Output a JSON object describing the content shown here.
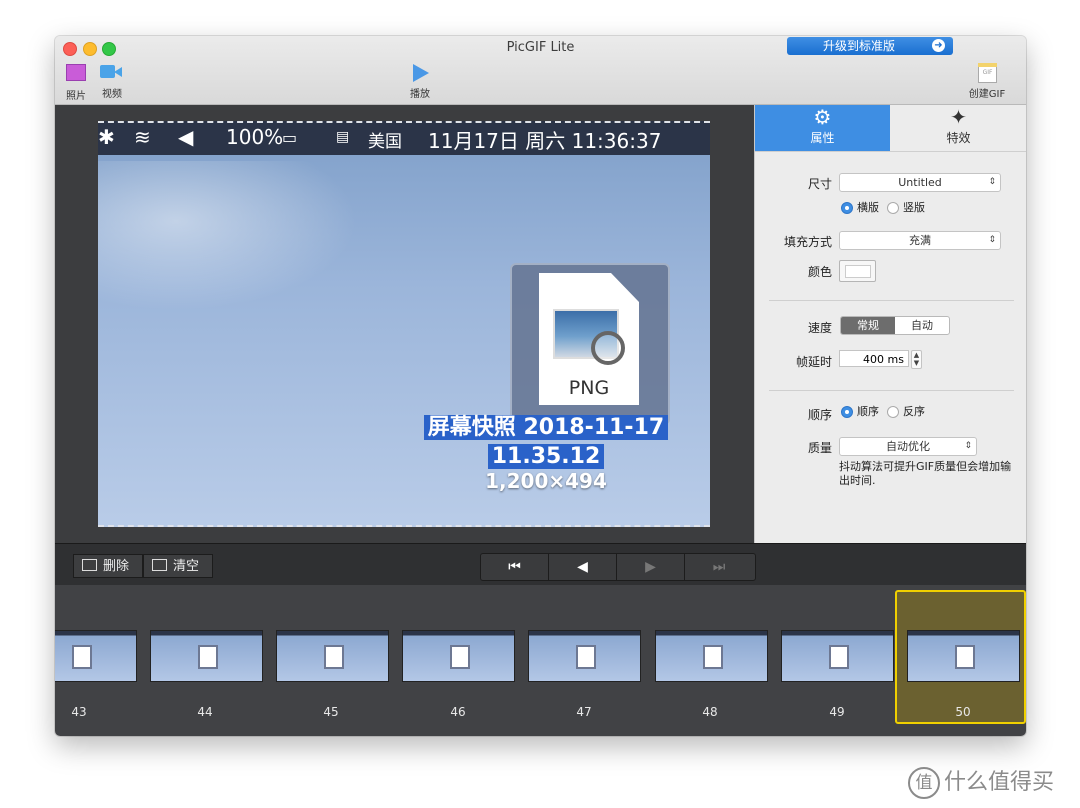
{
  "window": {
    "title": "PicGIF Lite",
    "upgrade_label": "升级到标准版"
  },
  "toolbar": {
    "photos": "照片",
    "video": "视频",
    "play": "播放",
    "create_gif": "创建GIF",
    "gif_icon_text": "GIF"
  },
  "preview": {
    "menubar": {
      "battery": "100%",
      "flag_lang": "美国",
      "datetime": "11月17日 周六  11:36:37"
    },
    "file_ext": "PNG",
    "filename_line1": "屏幕快照 2018-11-17",
    "filename_line2": "11.35.12",
    "dimensions": "1,200×494"
  },
  "sidebar": {
    "tabs": [
      {
        "label": "属性",
        "icon": "gear-icon"
      },
      {
        "label": "特效",
        "icon": "magic-wand-icon"
      }
    ],
    "size_label": "尺寸",
    "size_value": "Untitled",
    "orientation": [
      {
        "label": "横版",
        "checked": true
      },
      {
        "label": "竖版",
        "checked": false
      }
    ],
    "fill_label": "填充方式",
    "fill_value": "充满",
    "color_label": "颜色",
    "speed_label": "速度",
    "speed_options": [
      "常规",
      "自动"
    ],
    "delay_label": "帧延时",
    "delay_value": "400 ms",
    "order_label": "顺序",
    "order_options": [
      {
        "label": "顺序",
        "checked": true
      },
      {
        "label": "反序",
        "checked": false
      }
    ],
    "quality_label": "质量",
    "quality_value": "自动优化",
    "quality_note": "抖动算法可提升GIF质量但会增加输出时间."
  },
  "controls": {
    "delete_label": "删除",
    "clear_label": "清空"
  },
  "frames": [
    {
      "num": "43"
    },
    {
      "num": "44"
    },
    {
      "num": "45"
    },
    {
      "num": "46"
    },
    {
      "num": "47"
    },
    {
      "num": "48"
    },
    {
      "num": "49"
    },
    {
      "num": "50"
    }
  ],
  "watermark": {
    "symbol": "值",
    "text": "什么值得买"
  },
  "colors": {
    "accent": "#3e8ee3",
    "selection": "#f0d000"
  }
}
